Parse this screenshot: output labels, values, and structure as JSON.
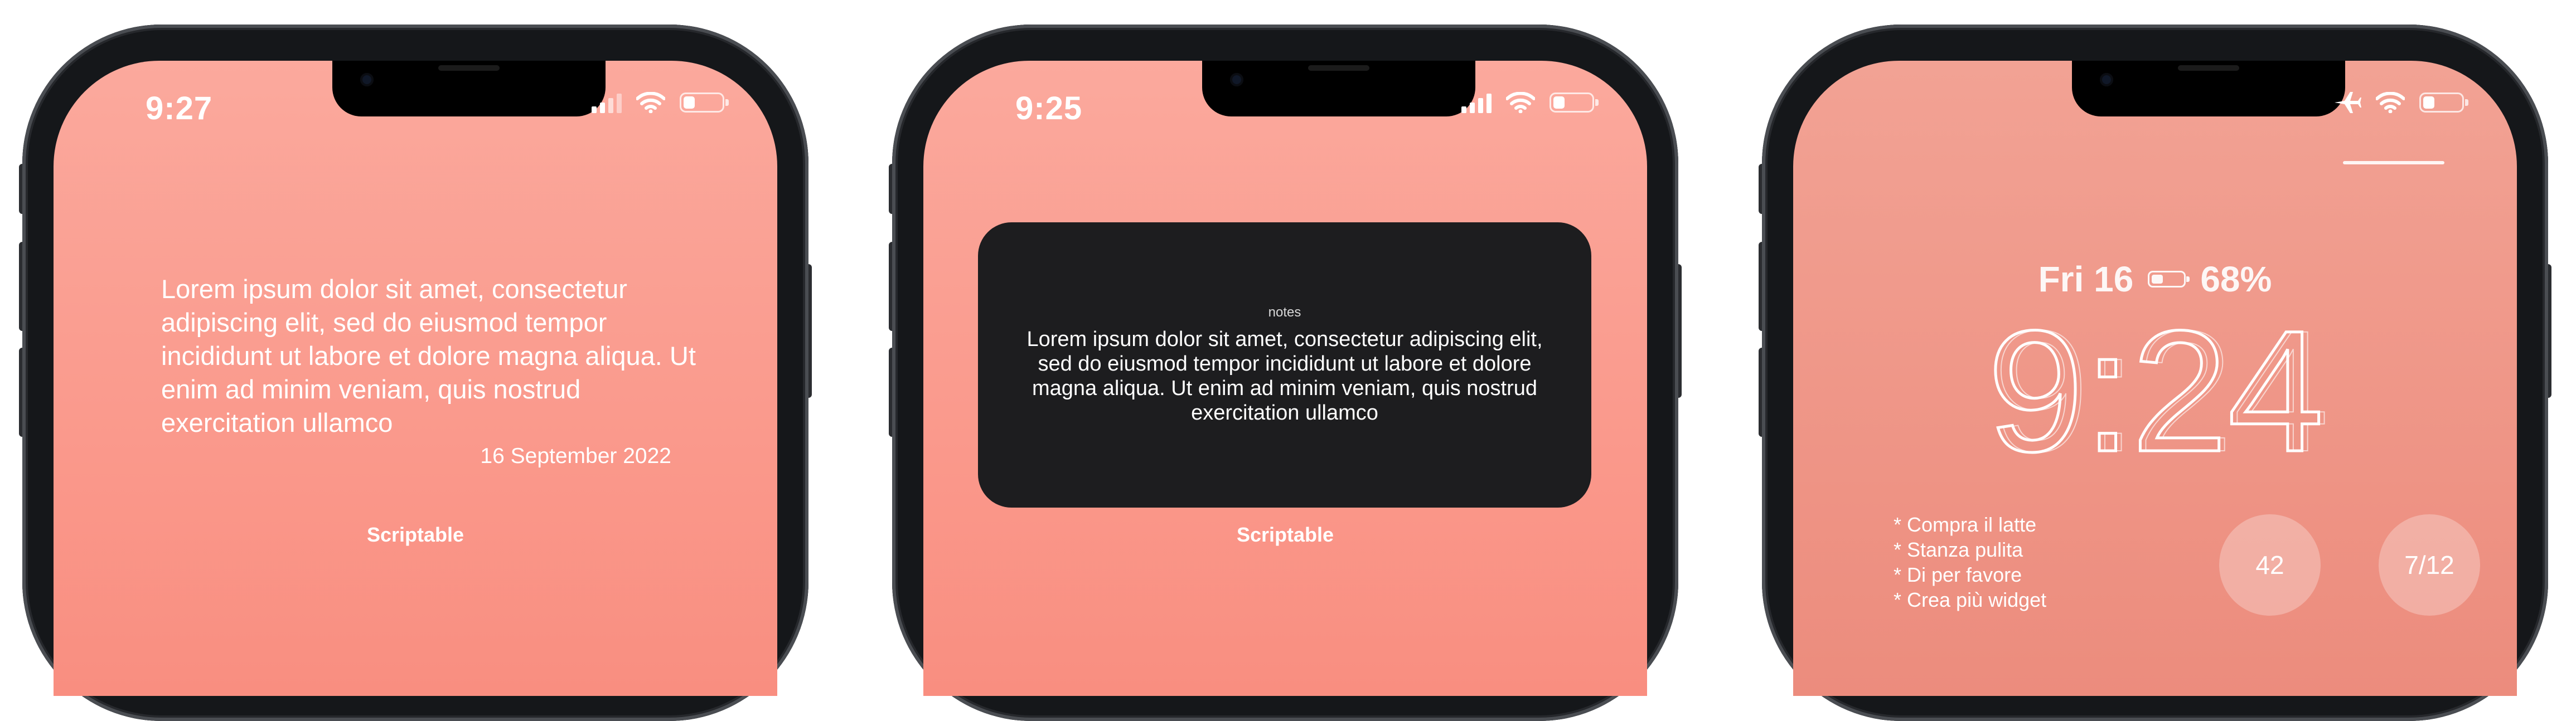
{
  "phones": [
    {
      "time": "9:27",
      "widget": {
        "text": "Lorem ipsum dolor sit amet, consectetur adipiscing elit, sed do eiusmod tempor incididunt ut labore et dolore magna aliqua. Ut enim ad minim veniam, quis nostrud exercitation ullamco",
        "date": "16 September 2022"
      },
      "app_label": "Scriptable"
    },
    {
      "time": "9:25",
      "widget": {
        "title": "notes",
        "text": "Lorem ipsum dolor sit amet, consectetur adipiscing elit, sed do eiusmod tempor incididunt ut labore et dolore magna aliqua. Ut enim ad minim veniam, quis nostrud exercitation ullamco"
      },
      "app_label": "Scriptable"
    },
    {
      "lock_date": "Fri 16",
      "battery_percent": "68%",
      "lock_time": "9:24",
      "todos": [
        "* Compra il latte",
        "* Stanza pulita",
        "* Di per favore",
        "* Crea più widget"
      ],
      "circles": [
        "42",
        "7/12"
      ]
    }
  ],
  "icons": {
    "signal": "cellular-signal-icon",
    "wifi": "wifi-icon",
    "battery": "battery-icon",
    "airplane": "airplane-icon"
  },
  "colors": {
    "wallpaper_top": "#fba99d",
    "wallpaper_bottom": "#f98e80",
    "widget_dark": "#1d1d1f",
    "frame": "#15171a"
  }
}
